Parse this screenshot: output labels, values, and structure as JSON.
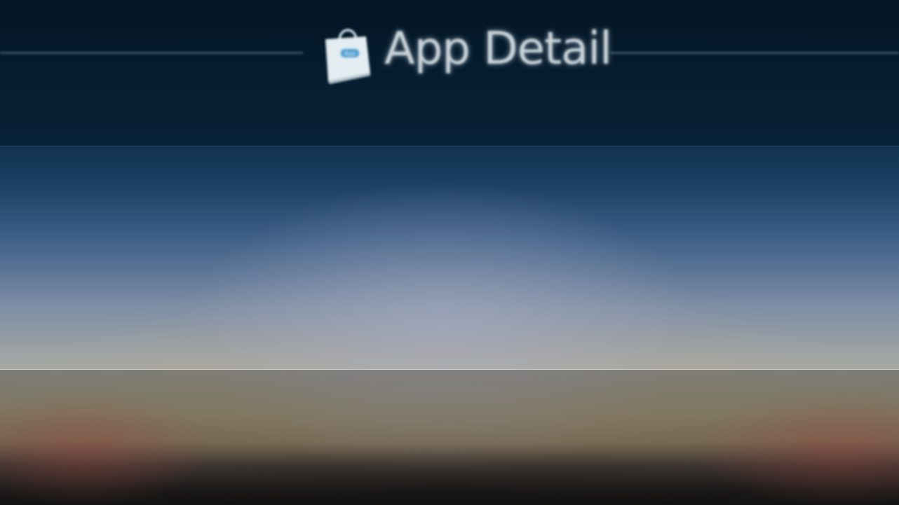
{
  "header": {
    "title": "App Detail",
    "icon": "shopping-bag-icon",
    "icon_badge": "App"
  },
  "colors": {
    "title_text": "#c9d3d9",
    "header_band": "#082236",
    "rule": "#6e8aa3"
  }
}
